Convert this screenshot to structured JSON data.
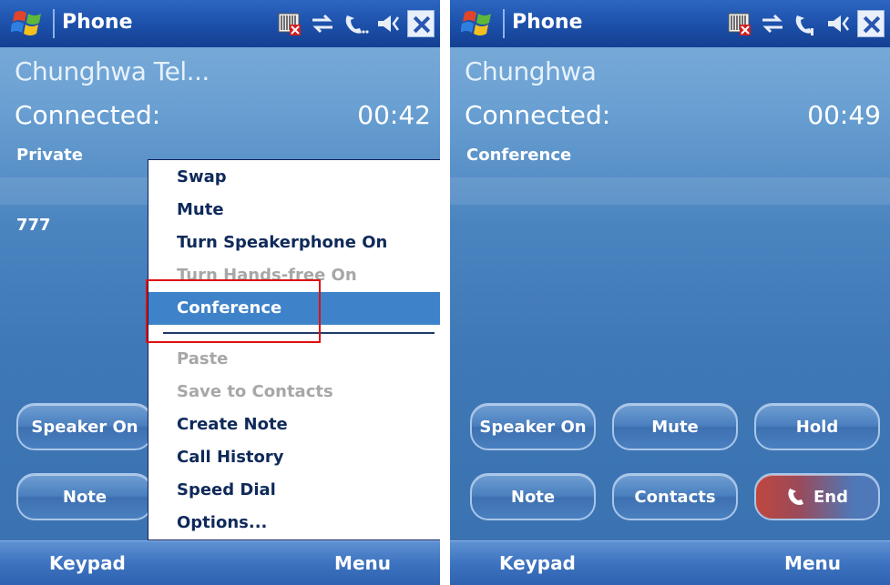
{
  "left_screen": {
    "app_title": "Phone",
    "carrier": "Chunghwa Tel...",
    "status": "Connected:",
    "timer": "00:42",
    "sub_label": "Private",
    "number": "777",
    "buttons": {
      "speaker": "Speaker On",
      "note": "Note"
    },
    "softkeys": {
      "left": "Keypad",
      "right": "Menu"
    },
    "menu": {
      "items": [
        {
          "label": "Swap",
          "state": "enabled"
        },
        {
          "label": "Mute",
          "state": "enabled"
        },
        {
          "label": "Turn Speakerphone On",
          "state": "enabled"
        },
        {
          "label": "Turn Hands-free On",
          "state": "disabled"
        },
        {
          "label": "Conference",
          "state": "selected"
        },
        {
          "label": "Paste",
          "state": "disabled"
        },
        {
          "label": "Save to Contacts",
          "state": "disabled"
        },
        {
          "label": "Create Note",
          "state": "enabled"
        },
        {
          "label": "Call History",
          "state": "enabled"
        },
        {
          "label": "Speed Dial",
          "state": "enabled"
        },
        {
          "label": "Options...",
          "state": "enabled"
        }
      ]
    }
  },
  "right_screen": {
    "app_title": "Phone",
    "carrier": "Chunghwa",
    "status": "Connected:",
    "timer": "00:49",
    "sub_label": "Conference",
    "buttons": {
      "speaker": "Speaker On",
      "mute": "Mute",
      "hold": "Hold",
      "note": "Note",
      "contacts": "Contacts",
      "end": "End"
    },
    "softkeys": {
      "left": "Keypad",
      "right": "Menu"
    }
  },
  "colors": {
    "highlight": "#e01010",
    "menu_selection": "#3e82c9",
    "end_button": "#c0473d"
  },
  "icons": [
    "windows-start-icon",
    "battery-warning-icon",
    "sync-arrows-icon",
    "phone-signal-icon",
    "speaker-volume-icon",
    "close-icon",
    "phone-handset-icon"
  ]
}
